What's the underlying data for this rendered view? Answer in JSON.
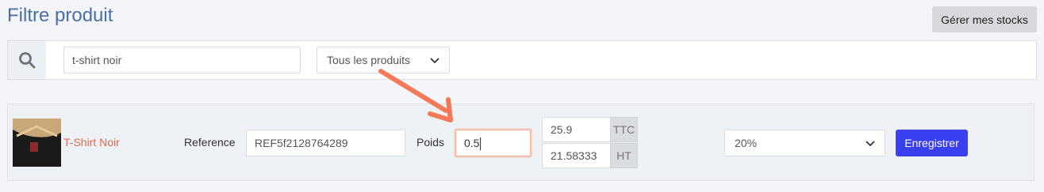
{
  "page": {
    "title": "Filtre produit",
    "stock_button": "Gérer mes stocks"
  },
  "filter": {
    "search_value": "t-shirt noir",
    "category_select": "Tous les produits"
  },
  "product": {
    "name": "T-Shirt Noir",
    "reference_label": "Reference",
    "reference_value": "REF5f2128764289",
    "weight_label": "Poids",
    "weight_value": "0.5",
    "price_ttc": "25.9",
    "price_ttc_suffix": "TTC",
    "price_ht": "21.58333",
    "price_ht_suffix": "HT",
    "tax_select": "20%",
    "save_button": "Enregistrer"
  },
  "icons": {
    "search": "search-icon",
    "chevron": "chevron-down-icon",
    "annotation": "arrow-annotation"
  },
  "colors": {
    "accent": "#3a3ff0",
    "title": "#4a6fa5",
    "product_name": "#e8684a",
    "annotation": "#f47a57"
  }
}
